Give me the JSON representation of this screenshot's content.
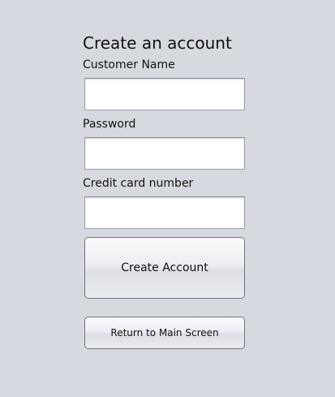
{
  "form": {
    "title": "Create an account",
    "customer_name": {
      "label": "Customer Name",
      "value": ""
    },
    "password": {
      "label": "Password",
      "value": ""
    },
    "credit_card": {
      "label": "Credit card number",
      "value": ""
    },
    "create_button": "Create Account",
    "return_button": "Return to Main Screen"
  }
}
